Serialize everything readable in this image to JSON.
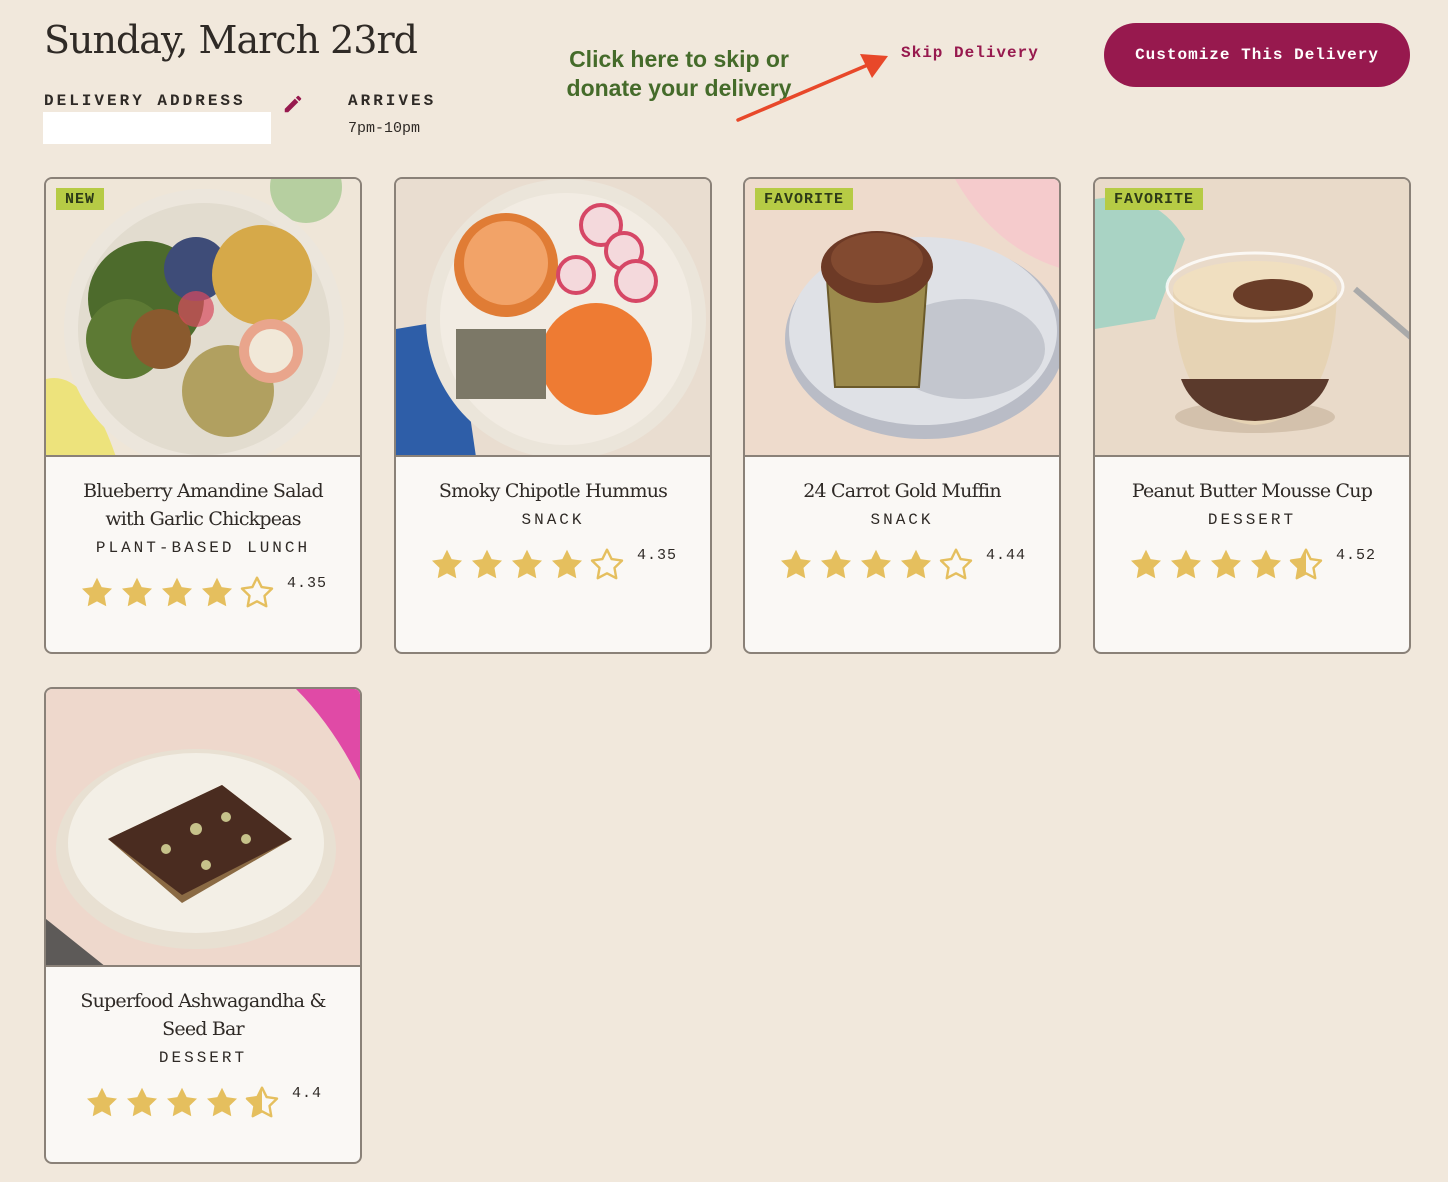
{
  "header": {
    "date": "Sunday, March 23rd",
    "delivery_address_label": "DELIVERY ADDRESS",
    "delivery_address_value": "",
    "arrives_label": "ARRIVES",
    "arrives_value": "7pm-10pm",
    "annotation": "Click here to skip or donate your delivery",
    "skip_label": "Skip Delivery",
    "customize_label": "Customize This Delivery"
  },
  "colors": {
    "background": "#f1e8dc",
    "accent": "#97194e",
    "badge": "#b6cb45",
    "star": "#e5bf5e",
    "annotation_text": "#456b2a",
    "annotation_arrow": "#e8482a"
  },
  "cards": [
    {
      "badge": "NEW",
      "name": "Blueberry Amandine Salad with Garlic Chickpeas",
      "category": "PLANT-BASED LUNCH",
      "rating": "4.35",
      "stars": [
        1,
        1,
        1,
        1,
        0
      ]
    },
    {
      "badge": "",
      "name": "Smoky Chipotle Hummus",
      "category": "SNACK",
      "rating": "4.35",
      "stars": [
        1,
        1,
        1,
        1,
        0
      ]
    },
    {
      "badge": "FAVORITE",
      "name": "24 Carrot Gold Muffin",
      "category": "SNACK",
      "rating": "4.44",
      "stars": [
        1,
        1,
        1,
        1,
        0
      ]
    },
    {
      "badge": "FAVORITE",
      "name": "Peanut Butter Mousse Cup",
      "category": "DESSERT",
      "rating": "4.52",
      "stars": [
        1,
        1,
        1,
        1,
        0.5
      ]
    },
    {
      "badge": "",
      "name": "Superfood Ashwagandha & Seed Bar",
      "category": "DESSERT",
      "rating": "4.4",
      "stars": [
        1,
        1,
        1,
        1,
        0.5
      ]
    }
  ]
}
